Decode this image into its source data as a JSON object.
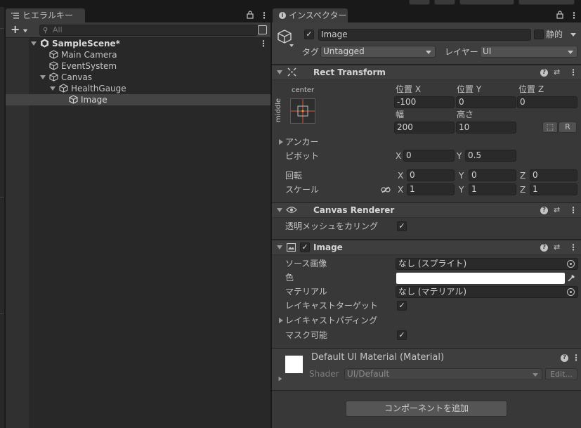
{
  "hierarchy": {
    "tab_label": "ヒエラルキー",
    "add_button": "+",
    "search_placeholder": "All",
    "items": [
      {
        "label": "SampleScene*"
      },
      {
        "label": "Main Camera"
      },
      {
        "label": "EventSystem"
      },
      {
        "label": "Canvas"
      },
      {
        "label": "HealthGauge"
      },
      {
        "label": "Image"
      }
    ]
  },
  "inspector": {
    "tab_label": "インスペクター",
    "object_name": "Image",
    "active": true,
    "static_label": "静的",
    "tag_label": "タグ",
    "tag_value": "Untagged",
    "layer_label": "レイヤー",
    "layer_value": "UI",
    "rect_transform": {
      "title": "Rect Transform",
      "anchor_h": "center",
      "anchor_v": "middle",
      "pos_x_label": "位置 X",
      "pos_y_label": "位置 Y",
      "pos_z_label": "位置 Z",
      "pos_x": "-100",
      "pos_y": "0",
      "pos_z": "0",
      "width_label": "幅",
      "height_label": "高さ",
      "width": "200",
      "height": "10",
      "r_button": "R",
      "anchors_label": "アンカー",
      "pivot_label": "ピボット",
      "pivot_x": "0",
      "pivot_y": "0.5",
      "rotation_label": "回転",
      "rot_x": "0",
      "rot_y": "0",
      "rot_z": "0",
      "scale_label": "スケール",
      "scale_x": "1",
      "scale_y": "1",
      "scale_z": "1",
      "axis_x": "X",
      "axis_y": "Y",
      "axis_z": "Z"
    },
    "canvas_renderer": {
      "title": "Canvas Renderer",
      "cull_label": "透明メッシュをカリング",
      "cull_checked": true
    },
    "image": {
      "title": "Image",
      "enabled": true,
      "source_label": "ソース画像",
      "source_value": "なし (スプライト)",
      "color_label": "色",
      "color_value": "#FFFFFF",
      "material_label": "マテリアル",
      "material_value": "なし (マテリアル)",
      "raycast_target_label": "レイキャストターゲット",
      "raycast_target": true,
      "raycast_padding_label": "レイキャストパディング",
      "maskable_label": "マスク可能",
      "maskable": true
    },
    "material": {
      "title": "Default UI Material (Material)",
      "shader_label": "Shader",
      "shader_value": "UI/Default",
      "edit_button": "Edit..."
    },
    "add_component_button": "コンポーネントを追加"
  },
  "colors": {
    "accent_check": "#dcdcdc",
    "selection": "#444444",
    "anchor_red": "#d45a3a"
  }
}
